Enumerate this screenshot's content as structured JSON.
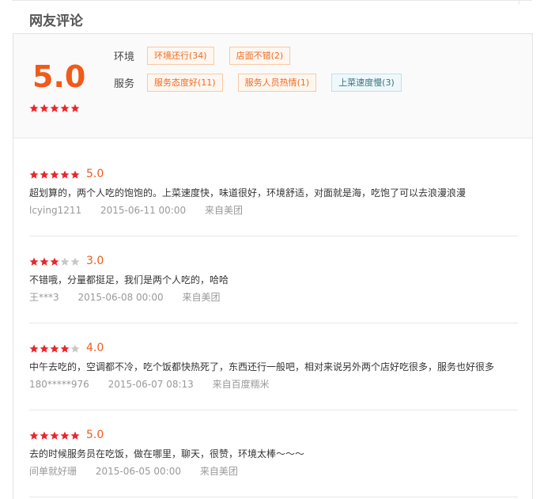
{
  "section_title": "网友评论",
  "summary": {
    "score": "5.0",
    "rating": 5,
    "groups": [
      {
        "category": "环境",
        "tags": [
          {
            "label": "环境还行(34)",
            "sentiment": "positive"
          },
          {
            "label": "店面不错(2)",
            "sentiment": "positive"
          }
        ]
      },
      {
        "category": "服务",
        "tags": [
          {
            "label": "服务态度好(11)",
            "sentiment": "positive"
          },
          {
            "label": "服务人员热情(1)",
            "sentiment": "positive"
          },
          {
            "label": "上菜速度慢(3)",
            "sentiment": "negative"
          }
        ]
      }
    ]
  },
  "reviews": [
    {
      "rating": 5,
      "score": "5.0",
      "text": "超划算的，两个人吃的饱饱的。上菜速度快，味道很好，环境舒适，对面就是海，吃饱了可以去浪漫浪漫",
      "user": "lcying1211",
      "time": "2015-06-11 00:00",
      "source": "来自美团"
    },
    {
      "rating": 3,
      "score": "3.0",
      "text": "不错哦，分量都挺足，我们是两个人吃的，哈哈",
      "user": "王***3",
      "time": "2015-06-08 00:00",
      "source": "来自美团"
    },
    {
      "rating": 4,
      "score": "4.0",
      "text": "中午去吃的，空调都不冷，吃个饭都快热死了，东西还行一般吧，相对来说另外两个店好吃很多，服务也好很多",
      "user": "180*****976",
      "time": "2015-06-07 08:13",
      "source": "来自百度糯米"
    },
    {
      "rating": 5,
      "score": "5.0",
      "text": "去的时候服务员在吃饭，做在哪里，聊天，很赞，环境太棒～～～",
      "user": "间单就好珊",
      "time": "2015-06-05 00:00",
      "source": "来自美团"
    }
  ],
  "colors": {
    "score_orange": "#f05a1a",
    "star_filled": "#e8262c",
    "star_empty": "#c8c8c8",
    "positive_tag_text": "#ef6b22",
    "negative_tag_text": "#3a6f7e"
  }
}
